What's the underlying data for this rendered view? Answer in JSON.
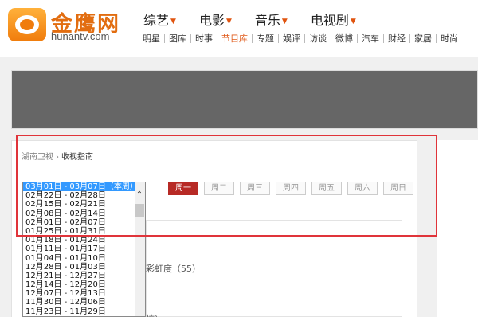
{
  "header": {
    "brand_cn": "金鹰网",
    "brand_en": "hunantv.com",
    "main_nav": [
      {
        "label": "综艺"
      },
      {
        "label": "电影"
      },
      {
        "label": "音乐"
      },
      {
        "label": "电视剧"
      }
    ],
    "sub_nav": [
      "明星",
      "图库",
      "时事",
      "节目库",
      "专题",
      "娱评",
      "访谈",
      "微博",
      "汽车",
      "财经",
      "家居",
      "时尚"
    ],
    "active_sub_nav": "节目库",
    "caret": "▼"
  },
  "breadcrumb": {
    "channel": "湖南卫视",
    "separator": "›",
    "current": "收视指南"
  },
  "week_select": {
    "options": [
      "03月01日 - 03月07日（本周）",
      "02月22日 - 02月28日",
      "02月15日 - 02月21日",
      "02月08日 - 02月14日",
      "02月01日 - 02月07日",
      "01月25日 - 01月31日",
      "01月18日 - 01月24日",
      "01月11日 - 01月17日",
      "01月04日 - 01月10日",
      "12月28日 - 01月03日",
      "12月21日 - 12月27日",
      "12月14日 - 12月20日",
      "12月07日 - 12月13日",
      "11月30日 - 12月06日",
      "11月23日 - 11月29日"
    ],
    "selected_index": 0,
    "scroll_up_icon": "⌃"
  },
  "day_tabs": [
    "周一",
    "周二",
    "周三",
    "周四",
    "周五",
    "周六",
    "周日"
  ],
  "active_day": "周一",
  "program_snippet": "彩虹度（55）",
  "program_snippet_2": "坊）",
  "colors": {
    "brand_orange": "#e26d10",
    "active_tab": "#b72a25",
    "selection": "#3399ff",
    "highlight_border": "#e0343a",
    "banner": "#666666"
  }
}
